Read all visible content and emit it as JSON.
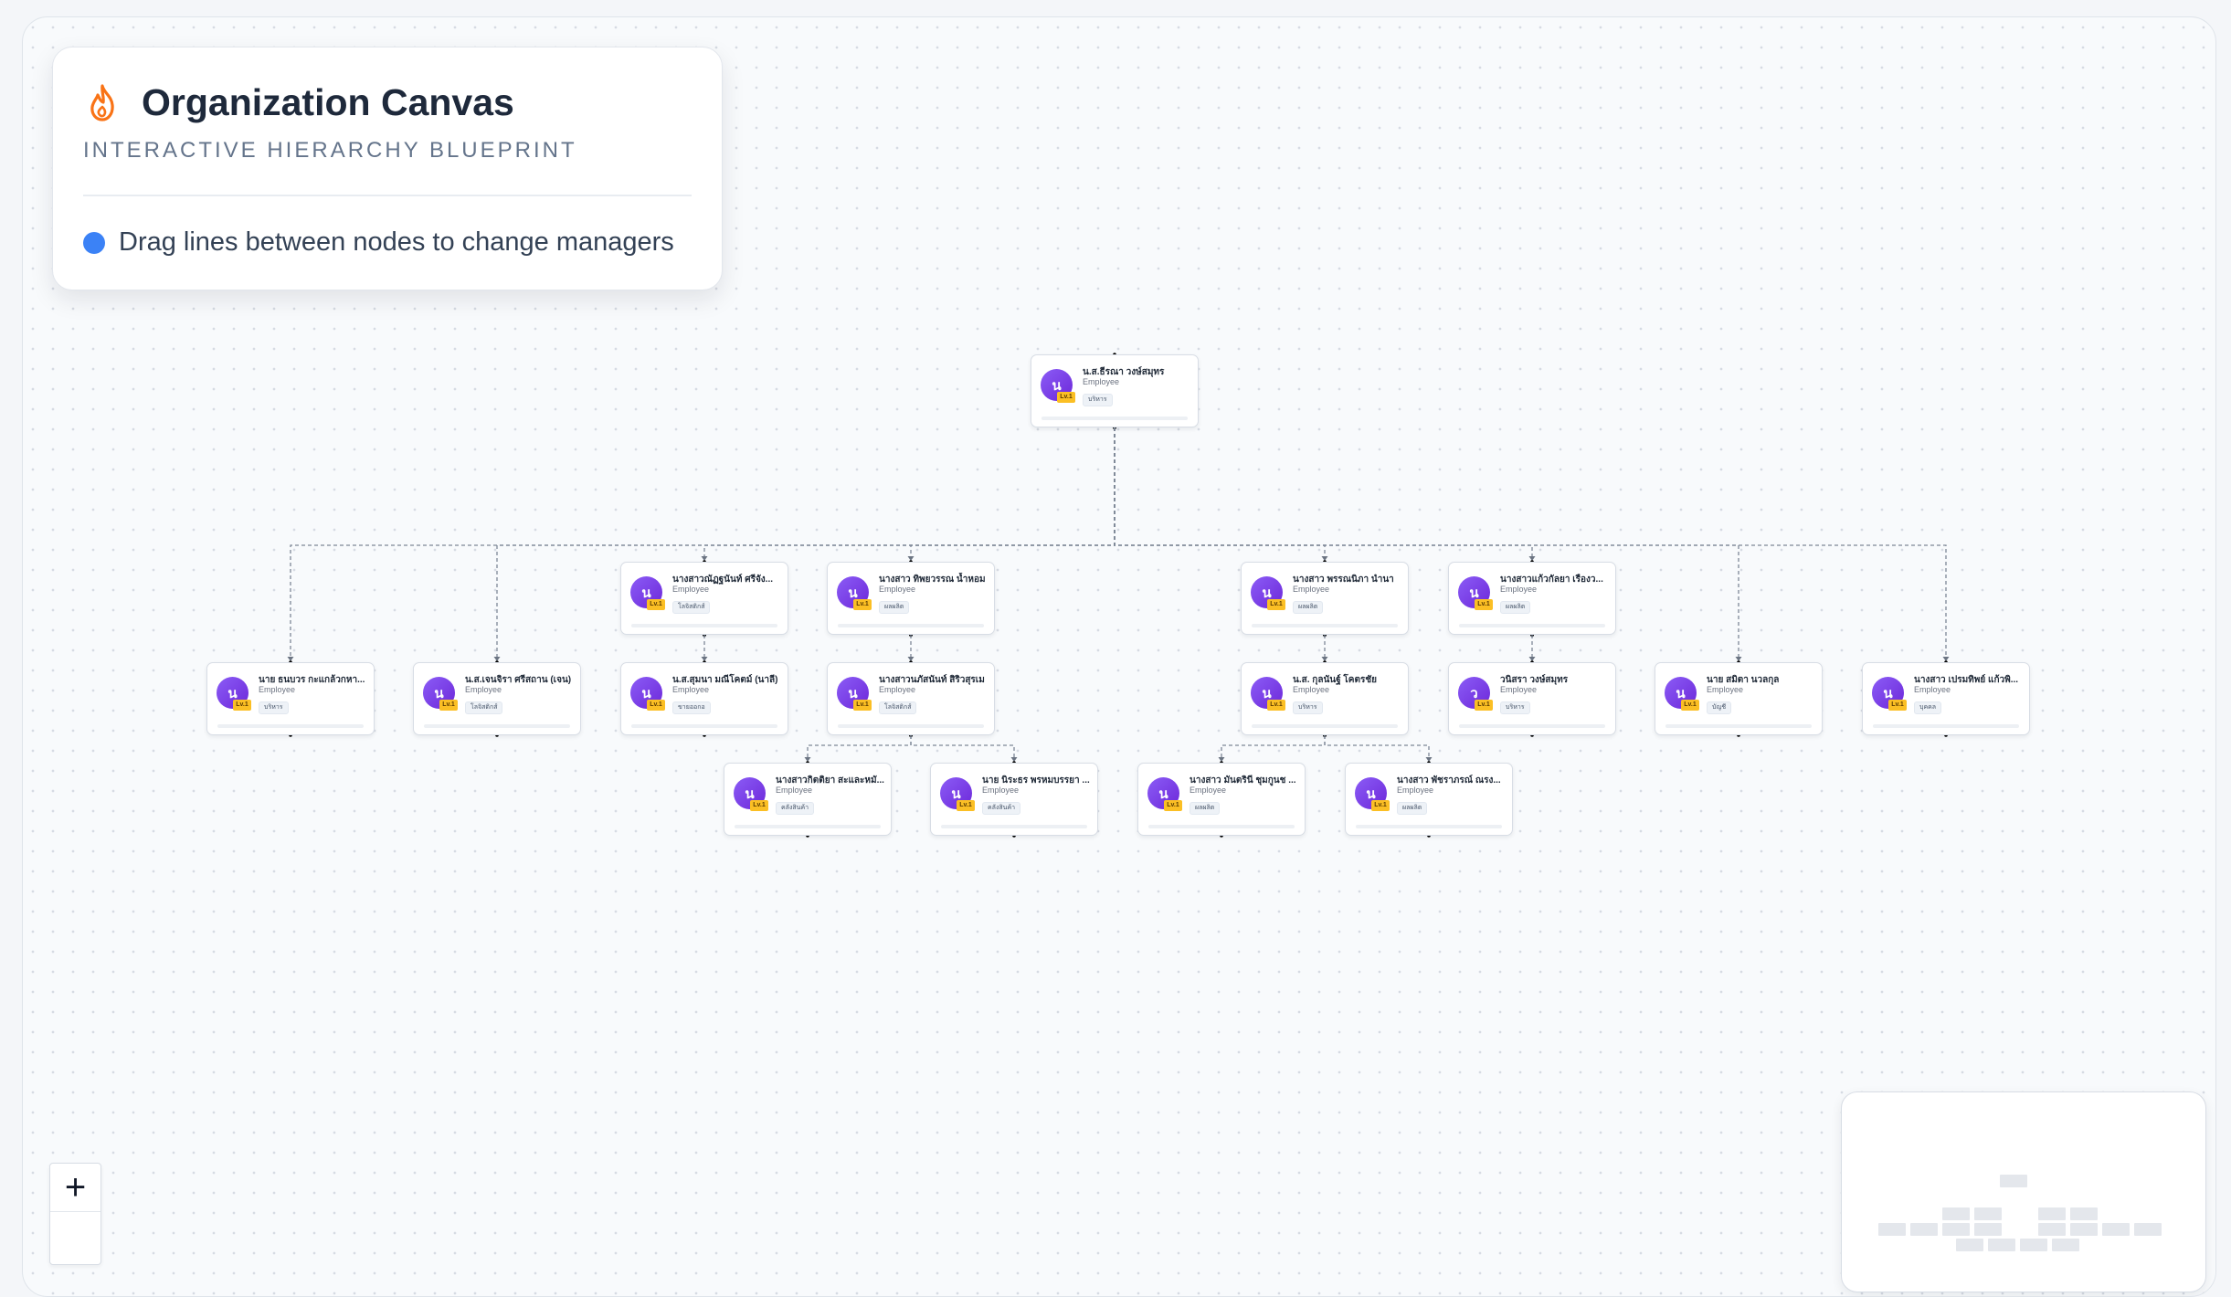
{
  "header": {
    "title": "Organization Canvas",
    "subtitle": "INTERACTIVE HIERARCHY BLUEPRINT",
    "hint": "Drag lines between nodes to change managers",
    "hint_color": "#3b82f6",
    "icon": "flame-icon"
  },
  "nodes": [
    {
      "id": "root",
      "name": "น.ส.ธีรณา วงษ์สมุทร",
      "role": "Employee",
      "dept": "บริหาร",
      "initial": "น",
      "level": "Lv.1"
    },
    {
      "id": "n1",
      "name": "นาย ธนบวร กะแกล้วกหา...",
      "role": "Employee",
      "dept": "บริหาร",
      "initial": "น",
      "level": "Lv.1"
    },
    {
      "id": "n2",
      "name": "น.ส.เจนจิรา ศรีสถาน (เจน)",
      "role": "Employee",
      "dept": "โลจิสติกส์",
      "initial": "น",
      "level": "Lv.1"
    },
    {
      "id": "n3",
      "name": "นางสาวณัฏฐนันท์ ศรีจัง...",
      "role": "Employee",
      "dept": "โลจิสติกส์",
      "initial": "น",
      "level": "Lv.1"
    },
    {
      "id": "n4",
      "name": "นางสาว ทิพยวรรณ น้ำหอม",
      "role": "Employee",
      "dept": "ผลผลิต",
      "initial": "น",
      "level": "Lv.1"
    },
    {
      "id": "n5",
      "name": "นางสาว พรรณนิภา นำนา",
      "role": "Employee",
      "dept": "ผลผลิต",
      "initial": "น",
      "level": "Lv.1"
    },
    {
      "id": "n6",
      "name": "นางสาวแก้วกัลยา เรืองว...",
      "role": "Employee",
      "dept": "ผลผลิต",
      "initial": "น",
      "level": "Lv.1"
    },
    {
      "id": "n7",
      "name": "นาย สมิตา นวลกุล",
      "role": "Employee",
      "dept": "บัญชี",
      "initial": "น",
      "level": "Lv.1"
    },
    {
      "id": "n8",
      "name": "นางสาว เปรมทิพย์ แก้วพิ...",
      "role": "Employee",
      "dept": "บุคคล",
      "initial": "น",
      "level": "Lv.1"
    },
    {
      "id": "n9",
      "name": "น.ส.สุมนา มณีโคตม์ (นาลี)",
      "role": "Employee",
      "dept": "ขายออกอ",
      "initial": "น",
      "level": "Lv.1"
    },
    {
      "id": "n10",
      "name": "นางสาวนภัสนันท์ สิริวสุรเม",
      "role": "Employee",
      "dept": "โลจิสติกส์",
      "initial": "น",
      "level": "Lv.1"
    },
    {
      "id": "n11",
      "name": "น.ส. กุลนันฐ์ โคตรชัย",
      "role": "Employee",
      "dept": "บริหาร",
      "initial": "น",
      "level": "Lv.1"
    },
    {
      "id": "n12",
      "name": "วนิสรา วงษ์สมุทร",
      "role": "Employee",
      "dept": "บริหาร",
      "initial": "ว",
      "level": "Lv.1"
    },
    {
      "id": "n13",
      "name": "นางสาวกิตติยา สะและหมั...",
      "role": "Employee",
      "dept": "คลังสินค้า",
      "initial": "น",
      "level": "Lv.1"
    },
    {
      "id": "n14",
      "name": "นาย นิระธร พรหมบรรยา ...",
      "role": "Employee",
      "dept": "คลังสินค้า",
      "initial": "น",
      "level": "Lv.1"
    },
    {
      "id": "n15",
      "name": "นางสาว มันตรินี ชุมกูนช ...",
      "role": "Employee",
      "dept": "ผลผลิต",
      "initial": "น",
      "level": "Lv.1"
    },
    {
      "id": "n16",
      "name": "นางสาว พัชราภรณ์ ณรง...",
      "role": "Employee",
      "dept": "ผลผลิต",
      "initial": "น",
      "level": "Lv.1"
    }
  ],
  "zoom": {
    "in_label": "+"
  },
  "colors": {
    "avatar": "#7c3aed",
    "level_badge": "#fbbf24",
    "accent": "#3b82f6",
    "icon": "#f97316"
  }
}
